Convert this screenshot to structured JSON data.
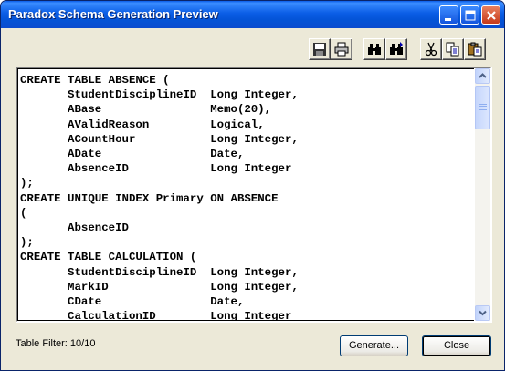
{
  "window": {
    "title": "Paradox Schema Generation Preview",
    "minimize_icon": "minimize-icon",
    "maximize_icon": "maximize-icon",
    "close_icon": "close-icon"
  },
  "toolbar": {
    "buttons": [
      {
        "name": "save-button",
        "icon": "save-icon"
      },
      {
        "name": "print-button",
        "icon": "printer-icon"
      },
      {
        "name": "find-button",
        "icon": "binoculars-icon"
      },
      {
        "name": "find-next-button",
        "icon": "binoculars-next-icon"
      },
      {
        "name": "cut-button",
        "icon": "scissors-icon"
      },
      {
        "name": "copy-button",
        "icon": "copy-icon"
      },
      {
        "name": "paste-button",
        "icon": "paste-icon"
      }
    ]
  },
  "editor": {
    "sql": "CREATE TABLE ABSENCE (\n       StudentDisciplineID  Long Integer,\n       ABase                Memo(20),\n       AValidReason         Logical,\n       ACountHour           Long Integer,\n       ADate                Date,\n       AbsenceID            Long Integer\n);\nCREATE UNIQUE INDEX Primary ON ABSENCE\n(\n       AbsenceID\n);\nCREATE TABLE CALCULATION (\n       StudentDisciplineID  Long Integer,\n       MarkID               Long Integer,\n       CDate                Date,\n       CalculationID        Long Integer"
  },
  "status": {
    "table_filter": "Table Filter: 10/10"
  },
  "buttons": {
    "generate": "Generate...",
    "close": "Close"
  }
}
